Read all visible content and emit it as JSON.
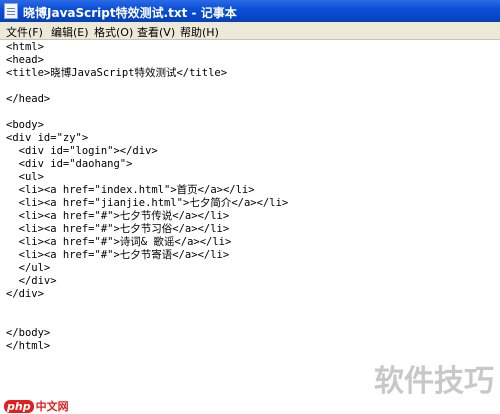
{
  "window": {
    "title": "晓博JavaScript特效测试.txt - 记事本"
  },
  "menu": [
    {
      "label": "文件(F)",
      "name": "menu-file"
    },
    {
      "label": "编辑(E)",
      "name": "menu-edit"
    },
    {
      "label": "格式(O)",
      "name": "menu-format"
    },
    {
      "label": "查看(V)",
      "name": "menu-view"
    },
    {
      "label": "帮助(H)",
      "name": "menu-help"
    }
  ],
  "document": {
    "lines": [
      "<html>",
      "<head>",
      "<title>晓博JavaScript特效测试</title>",
      "",
      "</head>",
      "",
      "<body>",
      "<div id=\"zy\">",
      "  <div id=\"login\"></div>",
      "  <div id=\"daohang\">",
      "  <ul>",
      "  <li><a href=\"index.html\">首页</a></li>",
      "  <li><a href=\"jianjie.html\">七夕简介</a></li>",
      "  <li><a href=\"#\">七夕节传说</a></li>",
      "  <li><a href=\"#\">七夕节习俗</a></li>",
      "  <li><a href=\"#\">诗词& 歌谣</a></li>",
      "  <li><a href=\"#\">七夕节寄语</a></li>",
      "  </ul>",
      "  </div>",
      "</div>",
      "",
      "",
      "</body>",
      "</html>"
    ]
  },
  "watermark": {
    "text": "软件技巧"
  },
  "logo": {
    "brand": "php",
    "suffix": "中文网"
  }
}
